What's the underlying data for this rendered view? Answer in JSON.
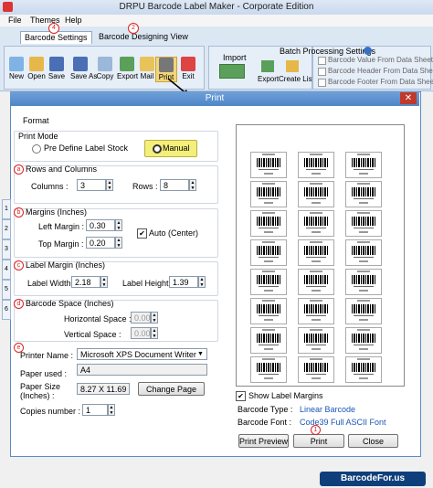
{
  "app": {
    "title": "DRPU Barcode Label Maker - Corporate Edition"
  },
  "menu": [
    "File",
    "Themes",
    "Help"
  ],
  "tabs": [
    "Barcode Settings",
    "Barcode Designing View"
  ],
  "toolbar": [
    "New",
    "Open",
    "Save",
    "Save As",
    "Copy",
    "Export",
    "Mail",
    "Print",
    "Exit"
  ],
  "import_group": {
    "title": "Import",
    "items": [
      "Export",
      "Create List"
    ]
  },
  "batch": {
    "title": "Batch Processing Settings",
    "options": [
      "Barcode Value From Data Sheet",
      "Barcode Header From Data Sheet",
      "Barcode Footer From Data Sheet"
    ]
  },
  "badges": {
    "tab": "4",
    "tab2": "2",
    "print": "1"
  },
  "dialog": {
    "title": "Print",
    "format_label": "Format",
    "print_mode": {
      "label": "Print Mode",
      "opt1": "Pre Define Label Stock",
      "opt2": "Manual"
    },
    "rows_cols": {
      "marker": "a",
      "title": "Rows and Columns",
      "columns_label": "Columns :",
      "columns": "3",
      "rows_label": "Rows :",
      "rows": "8"
    },
    "margins": {
      "marker": "b",
      "title": "Margins (Inches)",
      "left_label": "Left Margin :",
      "left": "0.30",
      "top_label": "Top Margin :",
      "top": "0.20",
      "auto": "Auto (Center)"
    },
    "label_margin": {
      "marker": "c",
      "title": "Label Margin (Inches)",
      "width_label": "Label Width :",
      "width": "2.18",
      "height_label": "Label Height :",
      "height": "1.39"
    },
    "barcode_space": {
      "marker": "d",
      "title": "Barcode Space (Inches)",
      "h_label": "Horizontal Space :",
      "h": "0.00",
      "v_label": "Vertical Space :",
      "v": "0.00"
    },
    "printer": {
      "marker": "e",
      "name_label": "Printer Name :",
      "name": "Microsoft XPS Document Writer",
      "paper_label": "Paper used :",
      "paper": "A4",
      "size_label": "Paper Size\n(Inches) :",
      "size": "8.27 X 11.69",
      "change": "Change Page",
      "copies_label": "Copies number :",
      "copies": "1"
    },
    "show_margins": "Show Label Margins",
    "barcode_type_label": "Barcode Type :",
    "barcode_type": "Linear Barcode",
    "barcode_font_label": "Barcode Font :",
    "barcode_font": "Code39 Full ASCII Font",
    "buttons": {
      "preview": "Print Preview",
      "print": "Print",
      "close": "Close"
    },
    "side_tabs": [
      "1",
      "2",
      "3",
      "4",
      "5",
      "6"
    ]
  },
  "watermark": "BarcodeFor.us",
  "colors": {
    "accent": "#4e86c8",
    "marker": "#dd2222",
    "link": "#1a55b8"
  }
}
